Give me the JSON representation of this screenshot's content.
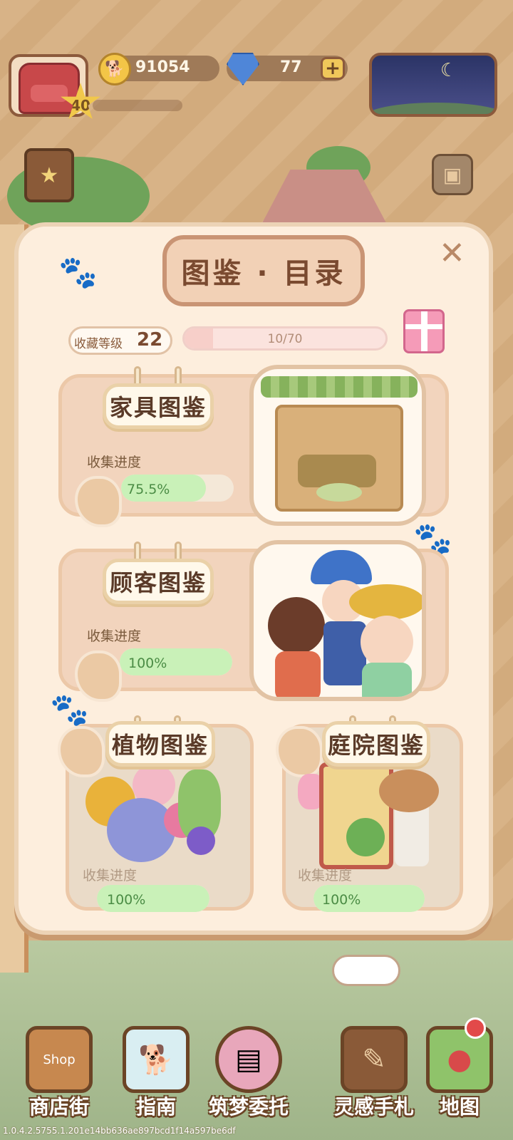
{
  "hud": {
    "player_level": "40",
    "coins": "91054",
    "coin_icon": "dog-coin-icon",
    "gems": "77",
    "gem_icon": "diamond-icon",
    "plus_label": "+"
  },
  "panel": {
    "title": "图鉴 · 目录",
    "close_label": "✕",
    "collection": {
      "label": "收藏等级",
      "level": "22",
      "progress_text": "10/70",
      "progress_fraction": 0.143
    }
  },
  "categories": [
    {
      "title": "家具图鉴",
      "progress_label": "收集进度",
      "progress_text": "75.5%",
      "progress_fraction": 0.755
    },
    {
      "title": "顾客图鉴",
      "progress_label": "收集进度",
      "progress_text": "100%",
      "progress_fraction": 1.0
    },
    {
      "title": "植物图鉴",
      "progress_label": "收集进度",
      "progress_text": "100%",
      "progress_fraction": 1.0
    },
    {
      "title": "庭院图鉴",
      "progress_label": "收集进度",
      "progress_text": "100%",
      "progress_fraction": 1.0
    }
  ],
  "nav": [
    {
      "label": "商店街",
      "icon": "shop-icon",
      "sign": "Shop"
    },
    {
      "label": "指南",
      "icon": "guide-icon"
    },
    {
      "label": "筑梦委托",
      "icon": "commission-icon"
    },
    {
      "label": "灵感手札",
      "icon": "notebook-icon"
    },
    {
      "label": "地图",
      "icon": "map-icon"
    }
  ],
  "version": "1.0.4.2.5755.1.201e14bb636ae897bcd1f14a597be6df",
  "colors": {
    "panel_bg": "#fdeedd",
    "progress_fill": "#c9f1b8",
    "title_text": "#7a4a30"
  }
}
